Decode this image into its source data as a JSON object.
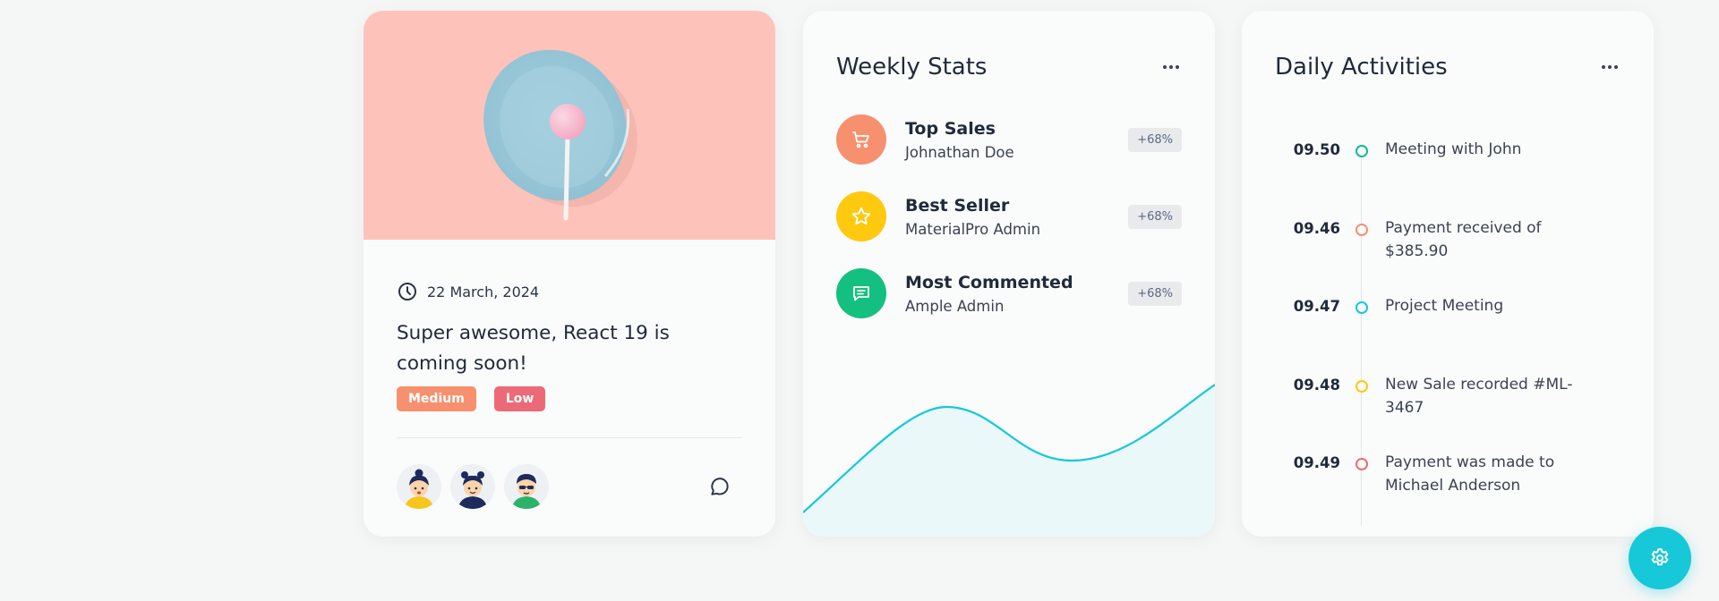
{
  "blog": {
    "date": "22 March, 2024",
    "title": "Super awesome, React 19 is coming soon!",
    "tags": [
      {
        "label": "Medium",
        "color": "#f7906f"
      },
      {
        "label": "Low",
        "color": "#ec6a78"
      }
    ],
    "avatars": [
      "avatar-user-1",
      "avatar-user-2",
      "avatar-user-3"
    ],
    "icons": {
      "date": "clock-icon",
      "comments": "comment-icon"
    },
    "image_background": "#fdc3bb"
  },
  "weekly_stats": {
    "title": "Weekly Stats",
    "items": [
      {
        "title": "Top Sales",
        "subtitle": "Johnathan Doe",
        "badge": "+68%",
        "icon": "cart-icon",
        "color": "#f7906f"
      },
      {
        "title": "Best Seller",
        "subtitle": "MaterialPro Admin",
        "badge": "+68%",
        "icon": "star-icon",
        "color": "#fec90f"
      },
      {
        "title": "Most Commented",
        "subtitle": "Ample Admin",
        "badge": "+68%",
        "icon": "message-icon",
        "color": "#13c07f"
      }
    ],
    "chart_color": "#16c8d8"
  },
  "daily_activities": {
    "title": "Daily Activities",
    "items": [
      {
        "time": "09.50",
        "text": "Meeting with John",
        "color": "#13b89a"
      },
      {
        "time": "09.46",
        "text": "Payment received of $385.90",
        "color": "#f7906f"
      },
      {
        "time": "09.47",
        "text": "Project Meeting",
        "color": "#16c8d8"
      },
      {
        "time": "09.48",
        "text": "New Sale recorded #ML-3467",
        "color": "#fec90f"
      },
      {
        "time": "09.49",
        "text": "Payment was made to Michael Anderson",
        "color": "#ec6a78"
      }
    ]
  },
  "settings": {
    "icon": "gear-icon",
    "color": "#16c8d8"
  }
}
